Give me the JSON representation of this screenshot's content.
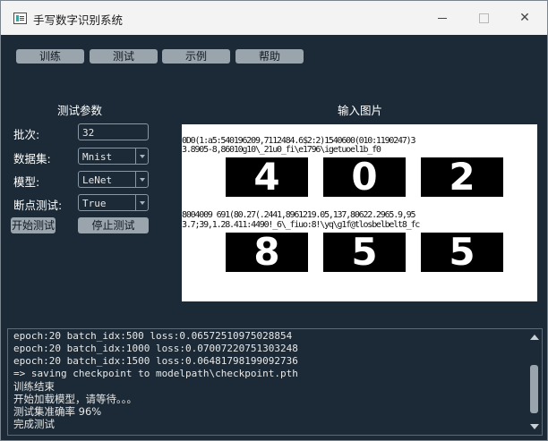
{
  "window": {
    "title": "手写数字识别系统",
    "close_glyph": "✕"
  },
  "menu": [
    {
      "label": "训练"
    },
    {
      "label": "测试"
    },
    {
      "label": "示例"
    },
    {
      "label": "帮助"
    }
  ],
  "params": {
    "heading": "测试参数",
    "batch": {
      "label": "批次:",
      "value": "32"
    },
    "dataset": {
      "label": "数据集:",
      "value": "Mnist"
    },
    "model": {
      "label": "模型:",
      "value": "LeNet"
    },
    "checkpoint": {
      "label": "断点测试:",
      "value": "True"
    },
    "start_button": "开始测试",
    "stop_button": "停止测试"
  },
  "preview": {
    "heading": "输入图片",
    "digits": [
      "4",
      "0",
      "2",
      "8",
      "5",
      "5"
    ],
    "noise_text": [
      "0D0(1:a5:540196209,7112484.6$2:2)1540600(010:1190247)3",
      "3.8905-8,86010g10\\_21u0_fi\\e1796\\igetuoel1b_f0",
      "8004009 691(80.27(.2441,8961219.05,137,80622.2965.9,95",
      "3.7;39,1.28.411:4490!_6\\_fiuo:8!\\yq\\g1f@tlosbelbelt8_fc"
    ]
  },
  "console": {
    "lines": [
      "epoch:20 batch_idx:500 loss:0.06572510975028854",
      "epoch:20 batch_idx:1000 loss:0.07007220751303248",
      "epoch:20 batch_idx:1500 loss:0.06481798199092736",
      "=> saving checkpoint to modelpath\\checkpoint.pth",
      "训练结束",
      "开始加载模型，请等待。。。",
      "测试集准确率 96%",
      "完成测试"
    ]
  }
}
